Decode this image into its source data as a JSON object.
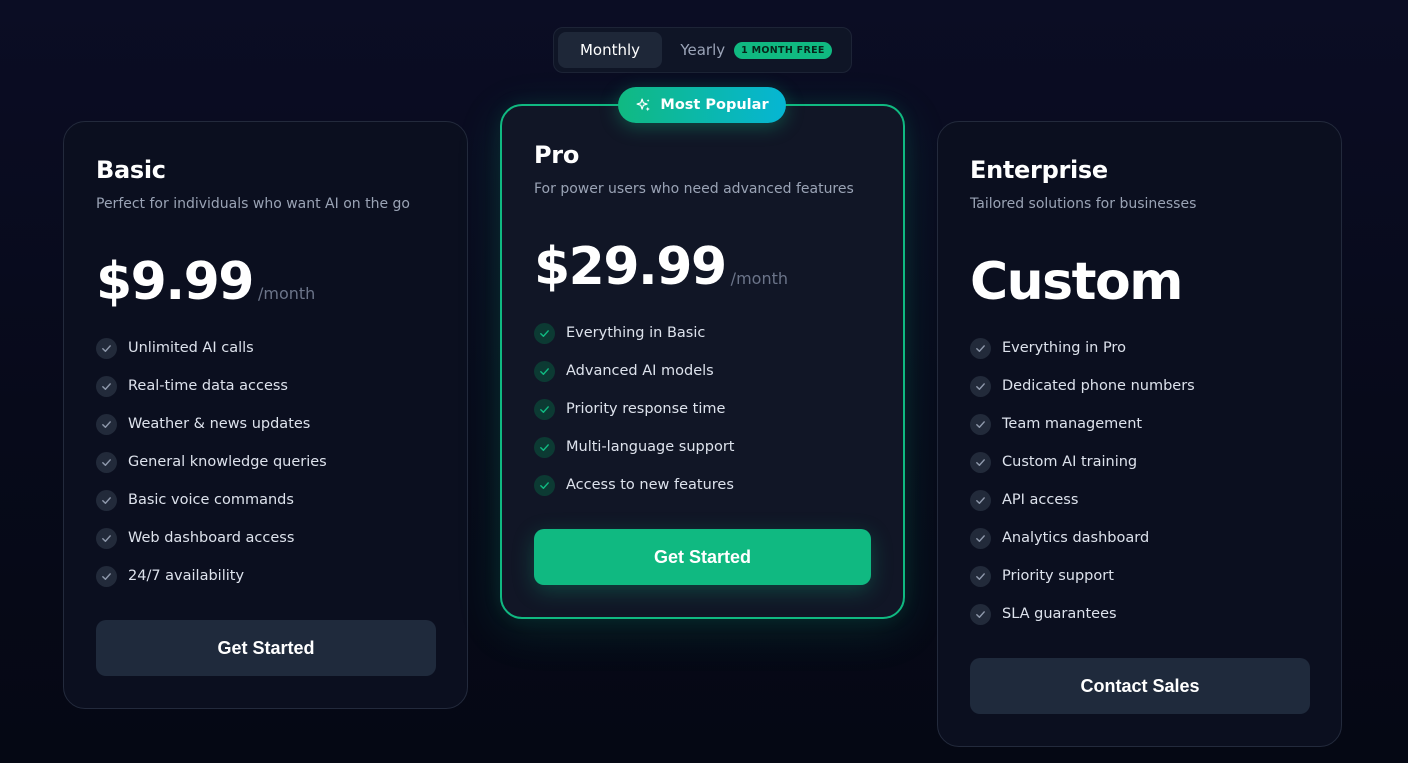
{
  "billing_toggle": {
    "monthly_label": "Monthly",
    "yearly_label": "Yearly",
    "yearly_badge": "1 MONTH FREE",
    "selected": "Monthly"
  },
  "colors": {
    "accent": "#10b981",
    "accent_secondary": "#06b6d4",
    "card_background": "#0b0f1f",
    "button_dark": "#1f2a3c"
  },
  "plans": [
    {
      "name": "Basic",
      "description": "Perfect for individuals who want AI on the go",
      "price": "$9.99",
      "price_unit": "/month",
      "features": [
        "Unlimited AI calls",
        "Real-time data access",
        "Weather & news updates",
        "General knowledge queries",
        "Basic voice commands",
        "Web dashboard access",
        "24/7 availability"
      ],
      "button_label": "Get Started"
    },
    {
      "name": "Pro",
      "badge": "Most Popular",
      "badge_icon": "sparkle-icon",
      "description": "For power users who need advanced features",
      "price": "$29.99",
      "price_unit": "/month",
      "features": [
        "Everything in Basic",
        "Advanced AI models",
        "Priority response time",
        "Multi-language support",
        "Access to new features"
      ],
      "button_label": "Get Started"
    },
    {
      "name": "Enterprise",
      "description": "Tailored solutions for businesses",
      "price": "Custom",
      "features": [
        "Everything in Pro",
        "Dedicated phone numbers",
        "Team management",
        "Custom AI training",
        "API access",
        "Analytics dashboard",
        "Priority support",
        "SLA guarantees"
      ],
      "button_label": "Contact Sales"
    }
  ]
}
